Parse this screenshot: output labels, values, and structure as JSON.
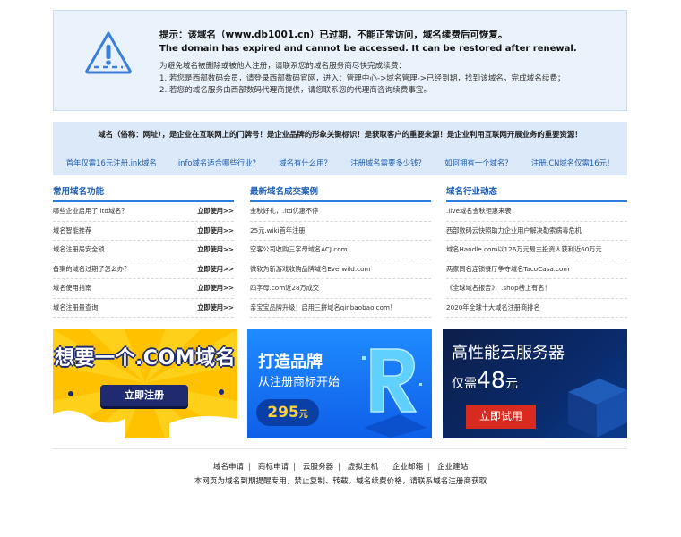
{
  "notice": {
    "title_cn": "提示：该域名（www.db1001.cn）已过期，不能正常访问，域名续费后可恢复。",
    "title_en": "The domain has expired and cannot be accessed. It can be restored after renewal.",
    "line1": "为避免域名被删除或被他人注册，请联系您的域名服务商尽快完成续费：",
    "line2": "1. 若您是西部数码会员，请登录西部数码官网，进入：管理中心->域名管理->已经到期，找到该域名，完成域名续费；",
    "line3": "2. 若您的域名服务由西部数码代理商提供，请您联系您的代理商咨询续费事宜。"
  },
  "banner": {
    "slogan": "域名（俗称：网址），是企业在互联网上的门牌号！是企业品牌的形象关键标识！是获取客户的重要来源！是企业利用互联网开展业务的重要资源！",
    "links": [
      "首年仅需16元注册.ink域名",
      ".info域名适合哪些行业？",
      "域名有什么用？",
      "注册域名需要多少钱？",
      "如何拥有一个域名？",
      "注册.CN域名仅需16元！"
    ]
  },
  "columns": [
    {
      "title": "常用域名功能",
      "rows": [
        {
          "text": "哪些企业启用了.ltd域名？",
          "action": "立即使用>>"
        },
        {
          "text": "域名智能推荐",
          "action": "立即使用>>"
        },
        {
          "text": "域名注册局安全锁",
          "action": "立即使用>>"
        },
        {
          "text": "备案的域名过期了怎么办？",
          "action": "立即使用>>"
        },
        {
          "text": "域名使用指南",
          "action": "立即使用>>"
        },
        {
          "text": "域名注册量查询",
          "action": "立即使用>>"
        }
      ]
    },
    {
      "title": "最新域名成交案例",
      "rows": [
        {
          "text": "金秋好礼，.ltd优惠不停",
          "action": ""
        },
        {
          "text": "25元.wiki首年注册",
          "action": ""
        },
        {
          "text": "空客公司收购三字母域名ACJ.com！",
          "action": ""
        },
        {
          "text": "微软为新游戏收购品牌域名Everwild.com",
          "action": ""
        },
        {
          "text": "四字母.com近28万成交",
          "action": ""
        },
        {
          "text": "亲宝宝品牌升级！启用三拼域名qinbaobao.com！",
          "action": ""
        }
      ]
    },
    {
      "title": "域名行业动态",
      "rows": [
        {
          "text": ".live域名金秋钜惠来袭",
          "action": ""
        },
        {
          "text": "西部数码云快照助力企业用户解决勒索病毒危机",
          "action": ""
        },
        {
          "text": "域名Handle.com以126万元易主投资人获利近60万元",
          "action": ""
        },
        {
          "text": "两家同名连锁餐厅争夺域名TacoCasa.com",
          "action": ""
        },
        {
          "text": "《全球域名报告》，.shop榜上有名！",
          "action": ""
        },
        {
          "text": "2020年全球十大域名注册商排名",
          "action": ""
        }
      ]
    }
  ],
  "ads": {
    "ad1": {
      "headline": "想要一个.COM域名",
      "button": "立即注册"
    },
    "ad2": {
      "headline": "打造品牌",
      "sub": "从注册商标开始",
      "price": "295",
      "unit": "元"
    },
    "ad3": {
      "headline": "高性能云服务器",
      "sub_prefix": "仅需",
      "price": "48",
      "unit": "元",
      "button": "立即试用"
    }
  },
  "footer": {
    "links": [
      "域名申请",
      "商标申请",
      "云服务器",
      "虚拟主机",
      "企业邮箱",
      "企业建站"
    ],
    "note": "本网页为域名到期提醒专用，禁止复制、转载。域名续费价格，请联系域名注册商获取"
  },
  "colors": {
    "accent": "#2d7de0",
    "link": "#1d5cb0",
    "notice_bg": "#eaf3fc",
    "banner_bg": "#dce9f8",
    "ad1_bg": "#ffd01a",
    "ad3_button": "#d82a1e"
  }
}
